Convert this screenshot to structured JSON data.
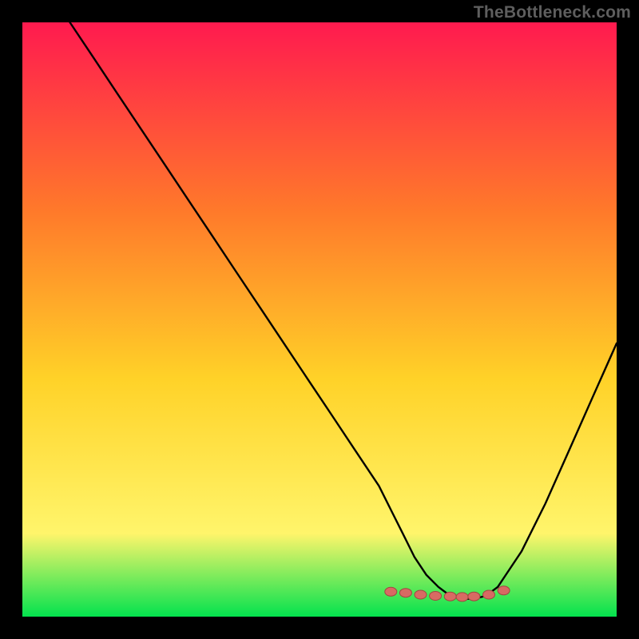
{
  "watermark": "TheBottleneck.com",
  "colors": {
    "gradient_top": "#ff1a4f",
    "gradient_mid1": "#ff7a2a",
    "gradient_mid2": "#ffd228",
    "gradient_mid3": "#fff56b",
    "gradient_bottom": "#03e24e",
    "curve": "#000000",
    "marker_fill": "#d86a63",
    "marker_stroke": "#a24642",
    "frame_bg": "#000000"
  },
  "chart_data": {
    "type": "line",
    "title": "",
    "xlabel": "",
    "ylabel": "",
    "xlim": [
      0,
      100
    ],
    "ylim": [
      0,
      100
    ],
    "grid": false,
    "series": [
      {
        "name": "bottleneck-curve",
        "x": [
          8,
          12,
          16,
          20,
          24,
          28,
          32,
          36,
          40,
          44,
          48,
          52,
          56,
          60,
          62,
          64,
          66,
          68,
          70,
          72,
          74,
          76,
          78,
          80,
          84,
          88,
          92,
          96,
          100
        ],
        "y": [
          100,
          94,
          88,
          82,
          76,
          70,
          64,
          58,
          52,
          46,
          40,
          34,
          28,
          22,
          18,
          14,
          10,
          7,
          5,
          3.5,
          3,
          3,
          3.5,
          5,
          11,
          19,
          28,
          37,
          46
        ]
      }
    ],
    "markers": {
      "name": "highlight-points",
      "x": [
        62,
        64.5,
        67,
        69.5,
        72,
        74,
        76,
        78.5,
        81
      ],
      "y": [
        4.2,
        4,
        3.7,
        3.5,
        3.4,
        3.3,
        3.4,
        3.7,
        4.4
      ]
    }
  }
}
